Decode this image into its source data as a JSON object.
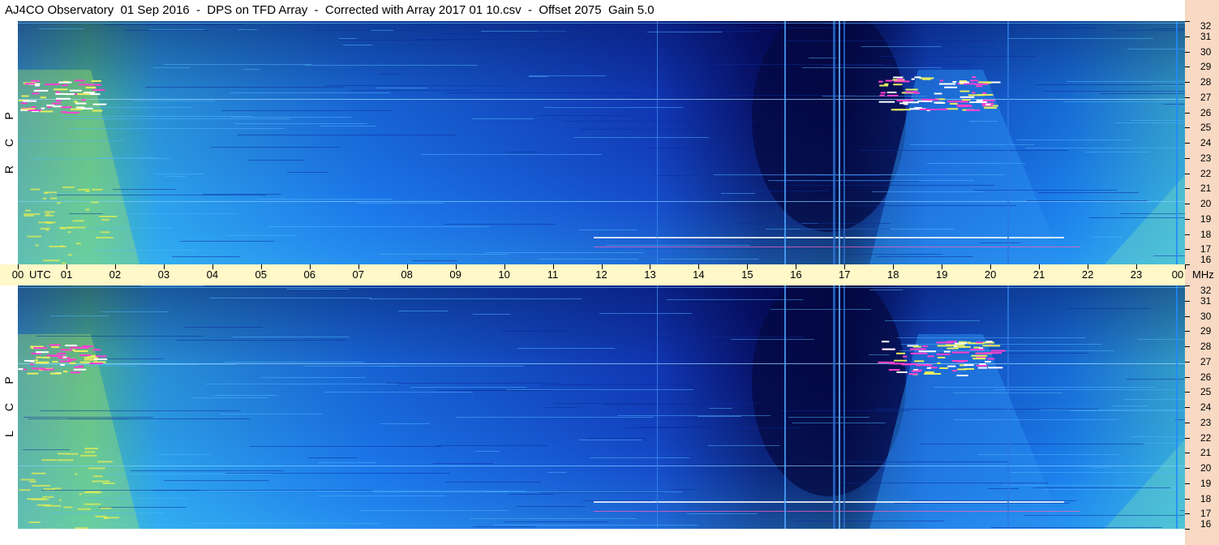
{
  "title": "AJ4CO Observatory  01 Sep 2016  -  DPS on TFD Array  -  Corrected with Array 2017 01 10.csv  -  Offset 2075  Gain 5.0",
  "panels": [
    {
      "id": "rcp",
      "label_letters": [
        "R",
        "C",
        "P"
      ]
    },
    {
      "id": "lcp",
      "label_letters": [
        "L",
        "C",
        "P"
      ]
    }
  ],
  "colors": {
    "background_blue": "#1a6fe6",
    "dark_blue": "#050a4a",
    "light_blue": "#2fb0ff",
    "green_yellow": "#c8f050",
    "magenta": "#ff40d0",
    "white": "#ffffff",
    "axis_band": "#fff8c8",
    "right_strip": "#f7d9c4"
  },
  "chart_data": {
    "type": "heatmap",
    "x_axis": {
      "unit": "UTC",
      "tick_labels": [
        "00",
        "01",
        "02",
        "03",
        "04",
        "05",
        "06",
        "07",
        "08",
        "09",
        "10",
        "11",
        "12",
        "13",
        "14",
        "15",
        "16",
        "17",
        "18",
        "19",
        "20",
        "21",
        "22",
        "23",
        "00"
      ],
      "range": [
        0,
        24
      ]
    },
    "y_axis": {
      "unit": "MHz",
      "tick_labels": [
        "32",
        "31",
        "30",
        "29",
        "28",
        "27",
        "26",
        "25",
        "24",
        "23",
        "22",
        "21",
        "20",
        "19",
        "18",
        "17",
        "16"
      ],
      "range": [
        16,
        32
      ]
    },
    "series": [
      {
        "name": "RCP"
      },
      {
        "name": "LCP"
      }
    ]
  }
}
